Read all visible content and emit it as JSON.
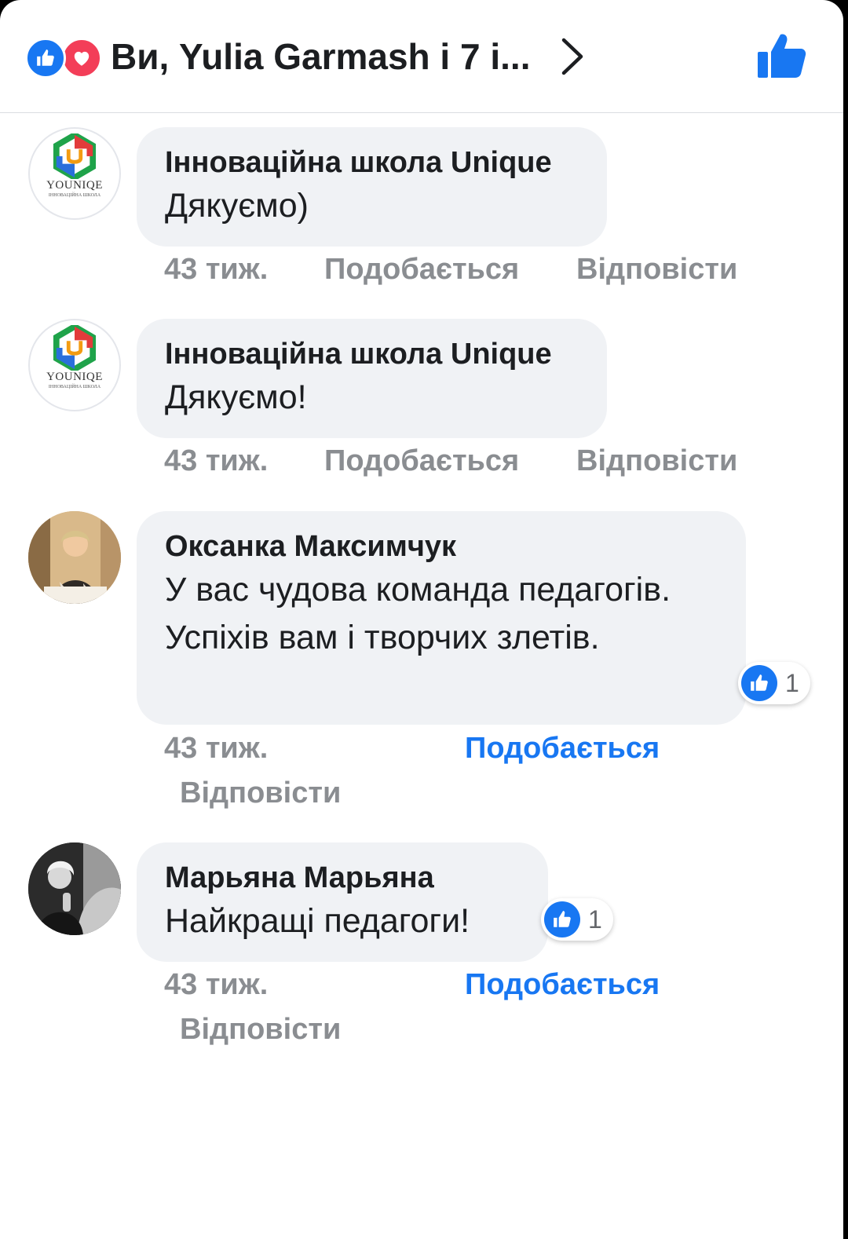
{
  "header": {
    "title": "Ви, Yulia Garmash і 7 і...",
    "reaction_icons": [
      "like-icon",
      "love-icon"
    ],
    "colors": {
      "like": "#1877f2",
      "love": "#f33e58"
    }
  },
  "comments": [
    {
      "author": "Інноваційна школа Unique",
      "text": "Дякуємо)",
      "time": "43 тиж.",
      "like_label": "Подобається",
      "reply_label": "Відповісти",
      "avatar": {
        "type": "logo",
        "word": "YOUNIQE",
        "sub": "ІННОВАЦІЙНА ШКОЛА"
      }
    },
    {
      "author": "Інноваційна школа Unique",
      "text": "Дякуємо!",
      "time": "43 тиж.",
      "like_label": "Подобається",
      "reply_label": "Відповісти",
      "avatar": {
        "type": "logo",
        "word": "YOUNIQE",
        "sub": "ІННОВАЦІЙНА ШКОЛА"
      }
    },
    {
      "author": "Оксанка Максимчук",
      "text": "У вас чудова команда педагогів. Успіхів вам  і творчих злетів.",
      "time": "43 тиж.",
      "like_label": "Подобається",
      "reply_label": "Відповісти",
      "liked": true,
      "reaction_count": "1",
      "avatar": {
        "type": "photo"
      }
    },
    {
      "author": "Марьяна Марьяна",
      "text": "Найкращі педагоги!",
      "time": "43 тиж.",
      "like_label": "Подобається",
      "reply_label": "Відповісти",
      "liked": true,
      "reaction_count": "1",
      "avatar": {
        "type": "photo-bw"
      }
    }
  ]
}
